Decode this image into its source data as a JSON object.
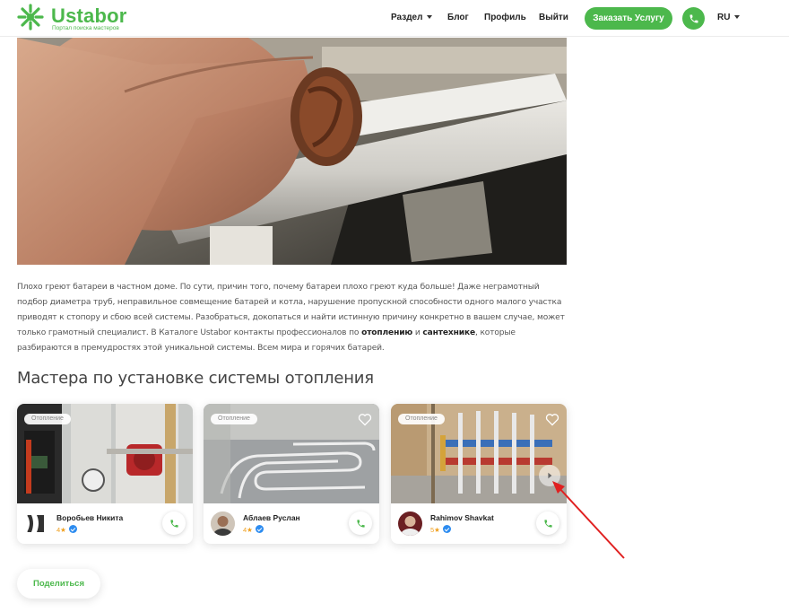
{
  "header": {
    "logo_name": "Ustabor",
    "logo_tagline": "Портал поиска мастеров",
    "nav": [
      {
        "label": "Раздел",
        "has_dropdown": true
      },
      {
        "label": "Блог"
      },
      {
        "label": "Профиль"
      },
      {
        "label": "Выйти"
      }
    ],
    "order_button": "Заказать Услугу",
    "phone_icon": "phone-icon",
    "language": "RU"
  },
  "article": {
    "p1": "Плохо греют батареи в частном доме. По сути, причин того, почему батареи плохо греют куда больше! Даже неграмотный подбор диаметра труб, неправильное совмещение батарей и котла, нарушение пропускной способности одного малого участка приводят к стопору и сбою всей системы. Разобраться, докопаться и найти истинную причину конкретно в вашем случае, может только грамотный специалист. В Каталоге Ustabor контакты профессионалов по ",
    "link1": "отоплению",
    "mid": " и ",
    "link2": "сантехнике",
    "p2": ", которые разбираются в премудростях этой уникальной системы. Всем мира и горячих батарей."
  },
  "section_title": "Мастера по установке системы отопления",
  "cards": [
    {
      "badge": "Отопление",
      "name": "Воробьев Никита",
      "rating": "4★"
    },
    {
      "badge": "Отопление",
      "name": "Аблаев Руслан",
      "rating": "4★"
    },
    {
      "badge": "Отопление",
      "name": "Rahimov Shavkat",
      "rating": "5★"
    }
  ],
  "share_button": "Поделиться",
  "colors": {
    "brand_green": "#4cb84c",
    "verified_blue": "#2d8cf0",
    "star": "#f0a020",
    "annotation_red": "#e02020"
  }
}
